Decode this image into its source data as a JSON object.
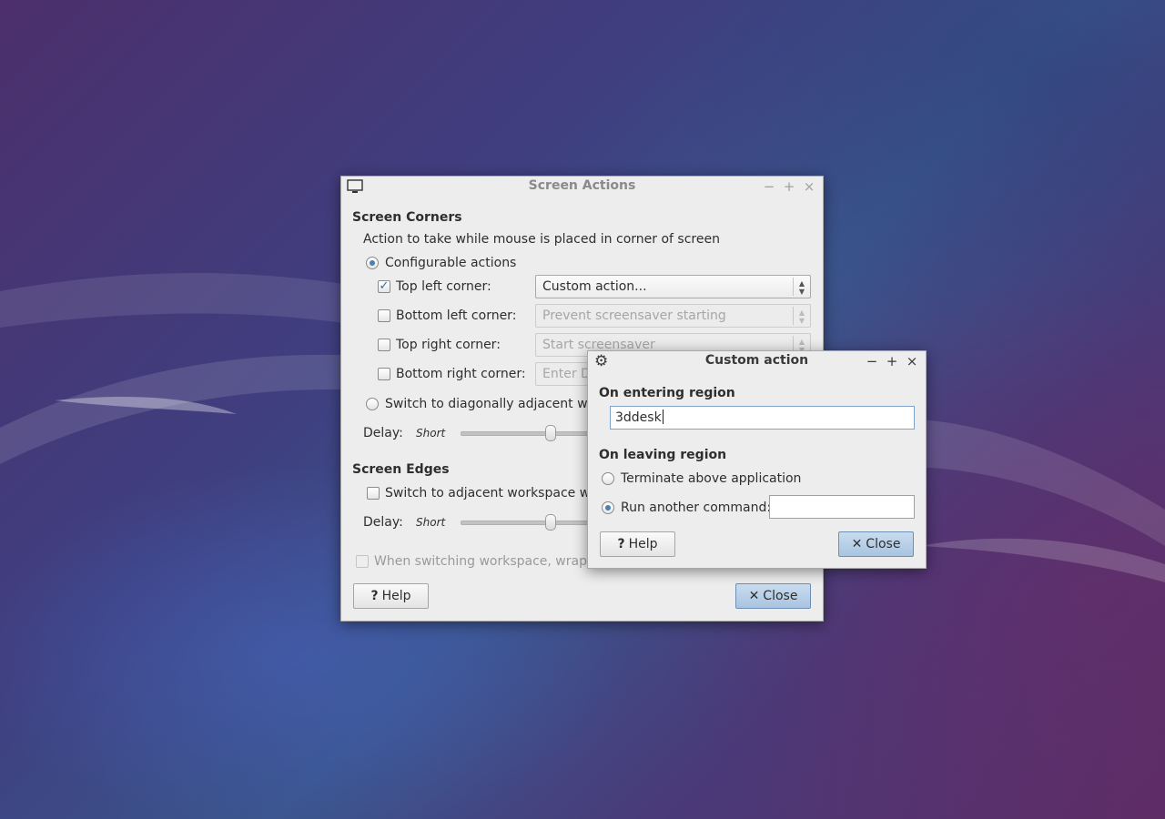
{
  "colors": {
    "dialog_bg": "#ededed",
    "accent": "#4f7fae",
    "primary_button": "#a9c4e0",
    "wallpaper_purple": "#4c2f6c",
    "wallpaper_blue": "#3a558c"
  },
  "screen_actions": {
    "title": "Screen Actions",
    "title_icon": "monitor-icon",
    "window_controls": [
      "minimize-icon",
      "maximize-icon",
      "close-icon"
    ],
    "corners_heading": "Screen Corners",
    "corners_description": "Action to take while mouse is placed in corner of screen",
    "configurable_label": "Configurable actions",
    "configurable_selected": true,
    "corners": [
      {
        "label": "Top left corner:",
        "checked": true,
        "value": "Custom action...",
        "enabled": true
      },
      {
        "label": "Bottom left corner:",
        "checked": false,
        "value": "Prevent screensaver starting",
        "enabled": false
      },
      {
        "label": "Top right corner:",
        "checked": false,
        "value": "Start screensaver",
        "enabled": false
      },
      {
        "label": "Bottom right corner:",
        "checked": false,
        "value": "Enter D",
        "enabled": false
      }
    ],
    "diagonal_label": "Switch to diagonally adjacent wor",
    "diagonal_selected": false,
    "delay_label": "Delay:",
    "delay_short": "Short",
    "corner_delay_fraction": 0.5,
    "edges_heading": "Screen Edges",
    "edges_switch_label": "Switch to adjacent workspace wh",
    "edges_switch_checked": false,
    "edges_delay_label": "Delay:",
    "edges_delay_short": "Short",
    "edges_delay_fraction": 0.5,
    "wrap_label": "When switching workspace, wrap a",
    "wrap_checked": false,
    "help_label": "Help",
    "close_label": "Close"
  },
  "custom_action": {
    "title": "Custom action",
    "title_icon": "gear-icon",
    "window_controls": [
      "minimize-icon",
      "maximize-icon",
      "close-icon"
    ],
    "entering_heading": "On entering region",
    "entering_value": "3ddesk",
    "leaving_heading": "On leaving region",
    "terminate_label": "Terminate above application",
    "terminate_selected": false,
    "run_label": "Run another command:",
    "run_selected": true,
    "run_value": "",
    "help_label": "Help",
    "close_label": "Close"
  }
}
